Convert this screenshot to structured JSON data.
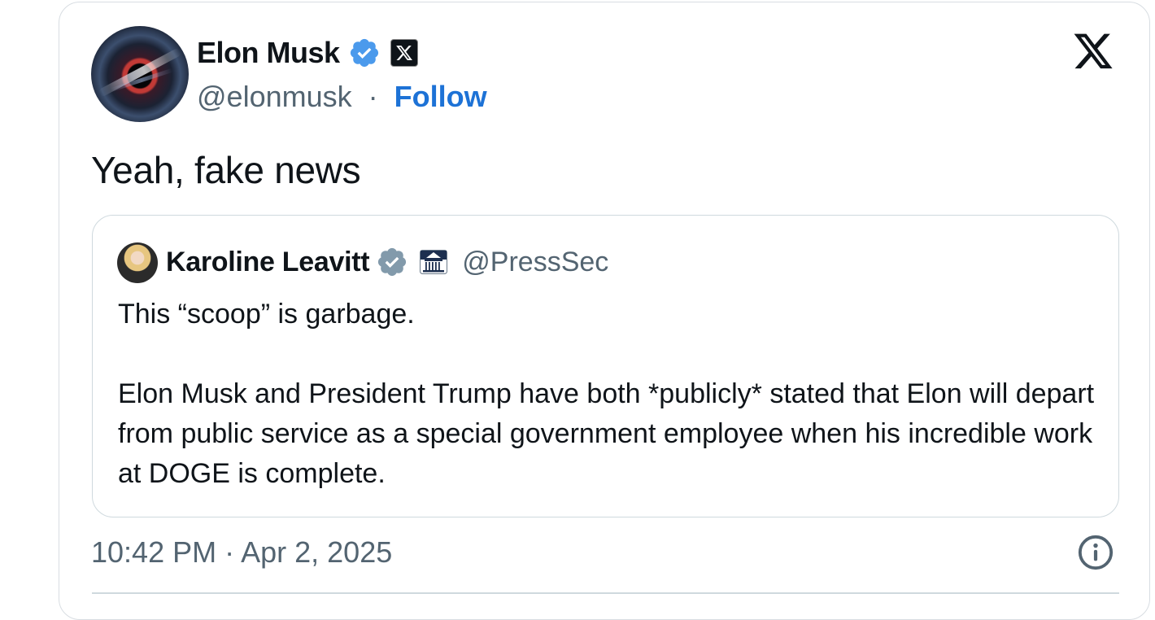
{
  "author": {
    "name": "Elon Musk",
    "handle": "@elonmusk",
    "separator": "·",
    "follow_label": "Follow",
    "avatar_icon": "black-hole-avatar",
    "verified_badge_color": "#4b9aec",
    "affiliate_icon": "x-affiliate-badge"
  },
  "brand": {
    "logo": "x-logo-icon"
  },
  "tweet": {
    "text": "Yeah, fake news"
  },
  "quoted_tweet": {
    "author_name": "Karoline Leavitt",
    "author_handle": "@PressSec",
    "verified_badge_color": "#829aab",
    "affiliate_icon": "white-house-badge",
    "paragraphs": [
      "This “scoop” is garbage.",
      "Elon Musk and President Trump have both *publicly* stated that Elon will depart from public service as a special government employee when his incredible work at DOGE is complete."
    ]
  },
  "footer": {
    "timestamp": "10:42 PM · Apr 2, 2025",
    "info_icon": "info-icon"
  },
  "colors": {
    "text": "#0f1419",
    "secondary": "#536471",
    "link": "#1d72d6",
    "border": "#cfd9de"
  }
}
